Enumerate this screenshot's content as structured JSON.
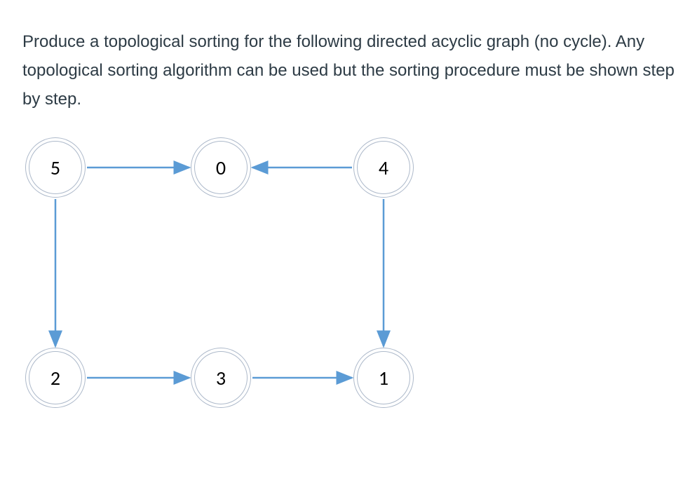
{
  "question": {
    "text": "Produce a topological sorting for the following directed acyclic graph (no cycle). Any topological sorting algorithm can be used but the sorting procedure must be shown step by step."
  },
  "graph": {
    "nodes": {
      "n5": "5",
      "n0": "0",
      "n4": "4",
      "n2": "2",
      "n3": "3",
      "n1": "1"
    },
    "edges": [
      {
        "from": "5",
        "to": "0"
      },
      {
        "from": "4",
        "to": "0"
      },
      {
        "from": "5",
        "to": "2"
      },
      {
        "from": "4",
        "to": "1"
      },
      {
        "from": "2",
        "to": "3"
      },
      {
        "from": "3",
        "to": "1"
      }
    ]
  }
}
